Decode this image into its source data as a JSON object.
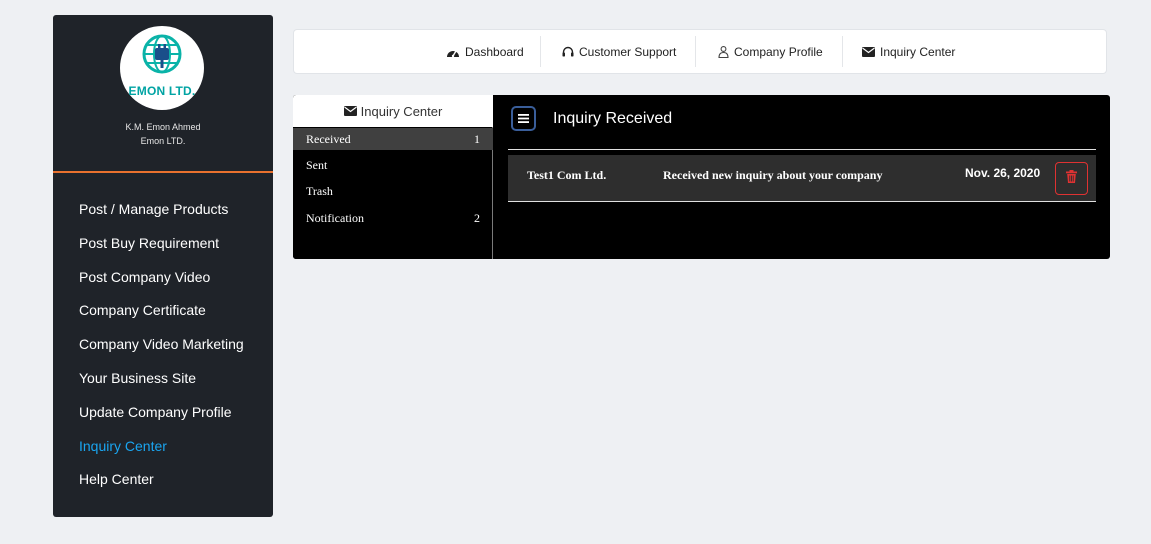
{
  "sidebar": {
    "logo_text": "EMON LTD.",
    "user_name": "K.M. Emon Ahmed",
    "user_company": "Emon LTD.",
    "menu": [
      {
        "label": "Post / Manage Products"
      },
      {
        "label": "Post Buy Requirement"
      },
      {
        "label": "Post Company Video"
      },
      {
        "label": "Company Certificate"
      },
      {
        "label": "Company Video Marketing"
      },
      {
        "label": "Your Business Site"
      },
      {
        "label": "Update Company Profile"
      },
      {
        "label": "Inquiry Center"
      },
      {
        "label": "Help Center"
      }
    ],
    "active_item": "Inquiry Center"
  },
  "topnav": {
    "items": [
      {
        "label": "Dashboard",
        "icon": "dashboard-icon"
      },
      {
        "label": "Customer Support",
        "icon": "headphones-icon"
      },
      {
        "label": "Company Profile",
        "icon": "user-icon"
      },
      {
        "label": "Inquiry Center",
        "icon": "envelope-icon"
      }
    ]
  },
  "inquiry": {
    "panel_title": "Inquiry Center",
    "folders": [
      {
        "label": "Received",
        "count": "1"
      },
      {
        "label": "Sent",
        "count": ""
      },
      {
        "label": "Trash",
        "count": ""
      },
      {
        "label": "Notification",
        "count": "2"
      }
    ],
    "active_folder": "Received",
    "main_title": "Inquiry Received",
    "messages": [
      {
        "sender": "Test1 Com Ltd.",
        "subject": "Received new inquiry about your company",
        "date": "Nov. 26, 2020"
      }
    ]
  },
  "colors": {
    "sidebar_bg": "#1f2329",
    "accent_orange": "#e8712e",
    "active_link": "#1aa5f0",
    "delete_red": "#e03232",
    "logo_teal": "#00a3a3"
  }
}
